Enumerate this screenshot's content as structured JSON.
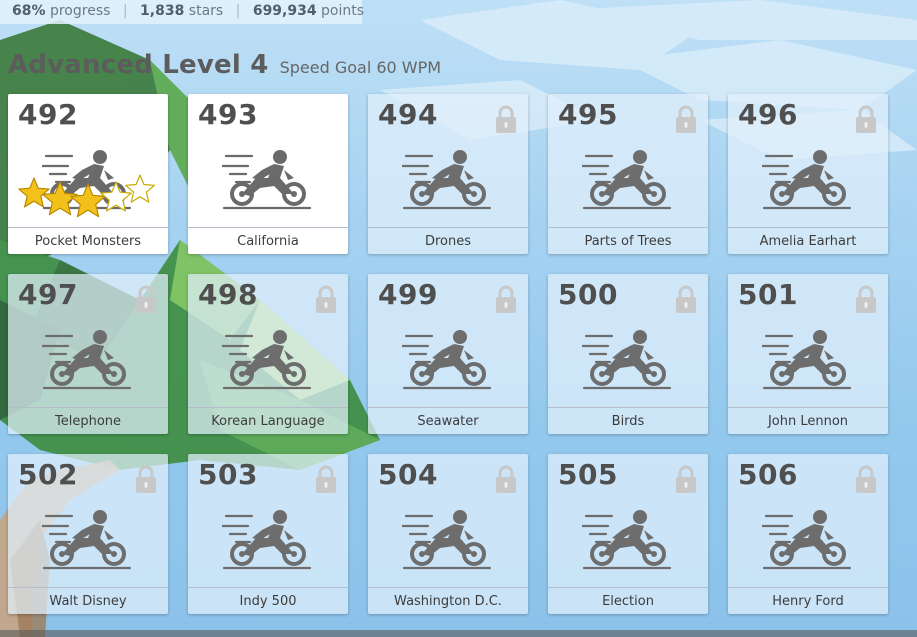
{
  "progress": {
    "percent": "68%",
    "percent_word": "progress",
    "stars": "1,838",
    "stars_word": "stars",
    "points": "699,934",
    "points_word": "points",
    "separator": "|"
  },
  "level": {
    "title": "Advanced Level 4",
    "subtitle": "Speed Goal 60 WPM"
  },
  "lessons": [
    {
      "number": "492",
      "name": "Pocket Monsters",
      "locked": false,
      "stars": 3
    },
    {
      "number": "493",
      "name": "California",
      "locked": false,
      "stars": 0
    },
    {
      "number": "494",
      "name": "Drones",
      "locked": true
    },
    {
      "number": "495",
      "name": "Parts of Trees",
      "locked": true
    },
    {
      "number": "496",
      "name": "Amelia Earhart",
      "locked": true
    },
    {
      "number": "497",
      "name": "Telephone",
      "locked": true
    },
    {
      "number": "498",
      "name": "Korean Language",
      "locked": true
    },
    {
      "number": "499",
      "name": "Seawater",
      "locked": true
    },
    {
      "number": "500",
      "name": "Birds",
      "locked": true
    },
    {
      "number": "501",
      "name": "John Lennon",
      "locked": true
    },
    {
      "number": "502",
      "name": "Walt Disney",
      "locked": true
    },
    {
      "number": "503",
      "name": "Indy 500",
      "locked": true
    },
    {
      "number": "504",
      "name": "Washington D.C.",
      "locked": true
    },
    {
      "number": "505",
      "name": "Election",
      "locked": true
    },
    {
      "number": "506",
      "name": "Henry Ford",
      "locked": true
    }
  ],
  "icons": {
    "lock": "lock-icon",
    "bike": "motorcycle-rider-icon",
    "star": "star-icon"
  },
  "colors": {
    "star_filled": "#f2c21b",
    "star_empty": "#ffffff",
    "icon_gray": "#6a6a6a",
    "lock_gray": "#c8c8c8"
  }
}
